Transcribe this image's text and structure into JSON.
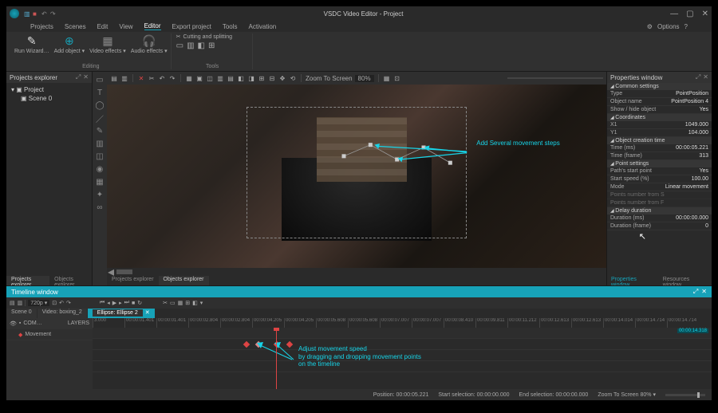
{
  "title": "VSDC Video Editor - Project",
  "menus": [
    "Projects",
    "Scenes",
    "Edit",
    "View",
    "Editor",
    "Export project",
    "Tools",
    "Activation"
  ],
  "active_menu": 4,
  "options_label": "Options",
  "ribbon": {
    "run": "Run\nWizard…",
    "add": "Add\nobject ▾",
    "video": "Video\neffects ▾",
    "audio": "Audio\neffects ▾",
    "group1": "Editing",
    "cut_split": "Cutting and splitting",
    "group2": "Tools"
  },
  "explorer": {
    "title": "Projects explorer",
    "root": "Project",
    "scene": "Scene 0",
    "tabs": [
      "Projects explorer",
      "Objects explorer"
    ]
  },
  "preview_toolbar": {
    "zoom_label": "Zoom To Screen",
    "zoom_pct": "80%"
  },
  "annotation1": "Add Several movement steps",
  "annotation2_l1": "Adjust movement speed",
  "annotation2_l2": "by dragging and dropping movement points",
  "annotation2_l3": "on the timeline",
  "properties": {
    "title": "Properties window",
    "sec_common": "Common settings",
    "type_k": "Type",
    "type_v": "PointPosition",
    "name_k": "Object name",
    "name_v": "PointPosition 4",
    "show_k": "Show / hide object",
    "show_v": "Yes",
    "sec_coord": "Coordinates",
    "x_k": "X1",
    "x_v": "1049.000",
    "y_k": "Y1",
    "y_v": "104.000",
    "sec_time": "Object creation time",
    "tms_k": "Time (ms)",
    "tms_v": "00:00:05.221",
    "tfr_k": "Time (frame)",
    "tfr_v": "313",
    "sec_point": "Point settings",
    "psp_k": "Path's start point",
    "psp_v": "Yes",
    "ss_k": "Start speed (%)",
    "ss_v": "100.00",
    "mode_k": "Mode",
    "mode_v": "Linear movement",
    "pfs_k": "Points number from S",
    "pfs_v": "—",
    "pff_k": "Points number from F",
    "pff_v": "—",
    "sec_delay": "Delay duration",
    "dms_k": "Duration (ms)",
    "dms_v": "00:00:00.000",
    "dfr_k": "Duration (frame)",
    "dfr_v": "0",
    "bottabs": [
      "Properties window",
      "Resources window"
    ]
  },
  "timeline": {
    "title": "Timeline window",
    "res": "720p ▾",
    "tabs": [
      "Scene 0",
      "Video: boxing_2",
      "Ellipse: Ellipse 2"
    ],
    "active_tab": 2,
    "layers_hdr": "LAYERS",
    "com_hdr": "COM…",
    "layer1": "Movement",
    "ticks": [
      "3.000",
      "00:00:01.401",
      "00:00:01.401",
      "00:00:02.804",
      "00:00:02.804",
      "00:00:04.205",
      "00:00:04.205",
      "00:00:05.608",
      "00:00:05.608",
      "00:00:07.007",
      "00:00:07.007",
      "00:00:08.410",
      "00:00:09.811",
      "00:00:11.212",
      "00:00:12.613",
      "00:00:12.613",
      "00:00:14.014",
      "00:00:14.714",
      "00:00:14.714"
    ],
    "end_label": "00:00:14.318"
  },
  "status": {
    "pos_k": "Position:",
    "pos_v": "00:00:05.221",
    "ss_k": "Start selection:",
    "ss_v": "00:00:00.000",
    "es_k": "End selection:",
    "es_v": "00:00:00.000",
    "zoom_k": "Zoom To Screen",
    "zoom_v": "80%"
  }
}
